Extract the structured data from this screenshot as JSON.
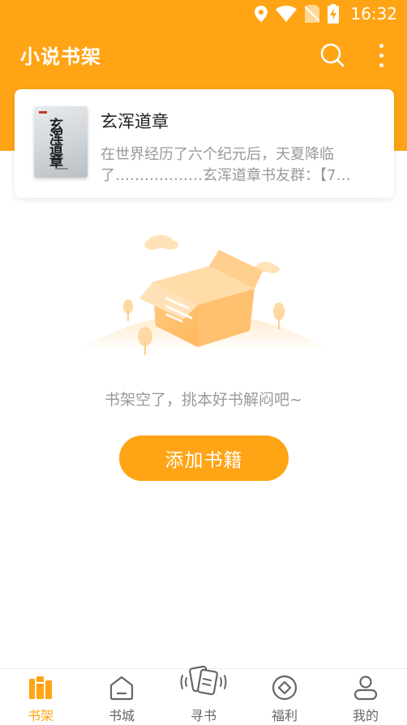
{
  "status_bar": {
    "time": "16:32",
    "icons": [
      "location-icon",
      "wifi-icon",
      "no-sim-icon",
      "battery-charging-icon"
    ]
  },
  "app_bar": {
    "title": "小说书架",
    "icons": [
      "search-icon",
      "more-vertical-icon"
    ]
  },
  "recommend_card": {
    "title": "玄浑道章",
    "description": "在世界经历了六个纪元后，天夏降临了………………玄浑道章书友群：【7…",
    "cover_text": "玄浑道章"
  },
  "empty_state": {
    "message": "书架空了，挑本好书解闷吧~",
    "add_button": "添加书籍"
  },
  "bottom_nav": {
    "items": [
      {
        "label": "书架",
        "icon": "bookshelf-icon",
        "active": true
      },
      {
        "label": "书城",
        "icon": "bookstore-icon",
        "active": false
      },
      {
        "label": "寻书",
        "icon": "find-book-cards-icon",
        "active": false
      },
      {
        "label": "福利",
        "icon": "coin-icon",
        "active": false
      },
      {
        "label": "我的",
        "icon": "profile-icon",
        "active": false
      }
    ]
  },
  "colors": {
    "accent": "#FFA415",
    "text_primary": "#222222",
    "text_secondary": "#999999"
  }
}
